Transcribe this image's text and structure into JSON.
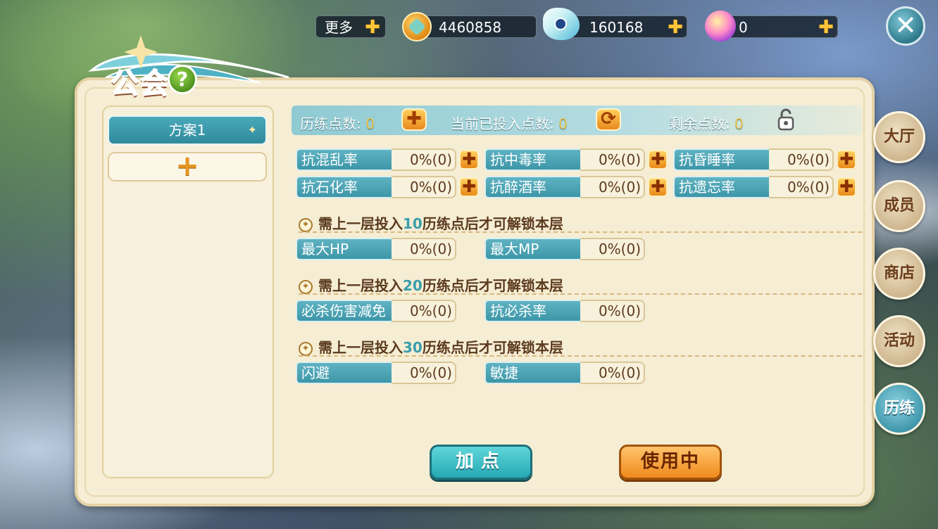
{
  "topbar": {
    "more_label": "更多",
    "currencies": [
      {
        "icon": "gold-coin-icon",
        "value": "4460858"
      },
      {
        "icon": "feather-ticket-icon",
        "value": "160168"
      },
      {
        "icon": "crystal-orb-icon",
        "value": "0"
      }
    ]
  },
  "panel": {
    "title": "公会",
    "help_label": "?"
  },
  "schemes": {
    "items": [
      {
        "label": "方案1"
      }
    ],
    "add_label": "+"
  },
  "points": {
    "training_label": "历练点数:",
    "training_value": "0",
    "invested_label": "当前已投入点数:",
    "invested_value": "0",
    "remaining_label": "剩余点数:",
    "remaining_value": "0"
  },
  "tier1": [
    {
      "name": "抗混乱率",
      "value": "0%(0)"
    },
    {
      "name": "抗中毒率",
      "value": "0%(0)"
    },
    {
      "name": "抗昏睡率",
      "value": "0%(0)"
    },
    {
      "name": "抗石化率",
      "value": "0%(0)"
    },
    {
      "name": "抗醉酒率",
      "value": "0%(0)"
    },
    {
      "name": "抗遗忘率",
      "value": "0%(0)"
    }
  ],
  "unlock_prefix": "需上一层投入",
  "unlock_suffix": "历练点后才可解锁本层",
  "tiers": [
    {
      "points": "10",
      "attrs": [
        {
          "name": "最大HP",
          "value": "0%(0)"
        },
        {
          "name": "最大MP",
          "value": "0%(0)"
        }
      ]
    },
    {
      "points": "20",
      "attrs": [
        {
          "name": "必杀伤害减免",
          "value": "0%(0)"
        },
        {
          "name": "抗必杀率",
          "value": "0%(0)"
        }
      ]
    },
    {
      "points": "30",
      "attrs": [
        {
          "name": "闪避",
          "value": "0%(0)"
        },
        {
          "name": "敏捷",
          "value": "0%(0)"
        }
      ]
    }
  ],
  "buttons": {
    "add_points": "加点",
    "in_use": "使用中"
  },
  "side_tabs": [
    {
      "label": "大厅"
    },
    {
      "label": "成员"
    },
    {
      "label": "商店"
    },
    {
      "label": "活动"
    },
    {
      "label": "历练",
      "active": true
    }
  ],
  "colors": {
    "accent_teal": "#3d97a8",
    "accent_orange": "#f08a1c",
    "panel_bg": "#f5edd4",
    "value_yellow": "#f3c84d"
  }
}
